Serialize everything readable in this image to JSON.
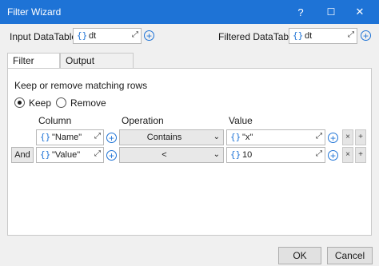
{
  "window": {
    "title": "Filter Wizard",
    "help_glyph": "?",
    "maximize_glyph": "☐",
    "close_glyph": "✕",
    "accent_color": "#1e73d6"
  },
  "inputs": {
    "input_label": "Input DataTable",
    "input_value": "dt",
    "output_label": "Filtered DataTable",
    "output_value": "dt",
    "brace": "{}",
    "expand_glyph": "⤢",
    "plus_glyph": "+"
  },
  "tabs": [
    {
      "label": "Filter Rows",
      "active": true
    },
    {
      "label": "Output Columns",
      "active": false
    }
  ],
  "filter": {
    "mode_label": "Keep or remove matching rows",
    "options": [
      {
        "label": "Keep",
        "selected": true
      },
      {
        "label": "Remove",
        "selected": false
      }
    ],
    "headers": {
      "column": "Column",
      "operation": "Operation",
      "value": "Value"
    },
    "rows": [
      {
        "conj": "",
        "column": "\"Name\"",
        "operation": "Contains",
        "value": "\"x\""
      },
      {
        "conj": "And",
        "column": "\"Value\"",
        "operation": "<",
        "value": "10"
      }
    ],
    "remove_glyph": "×",
    "add_glyph": "+",
    "dropdown_glyph": "⌄"
  },
  "footer": {
    "ok": "OK",
    "cancel": "Cancel"
  }
}
